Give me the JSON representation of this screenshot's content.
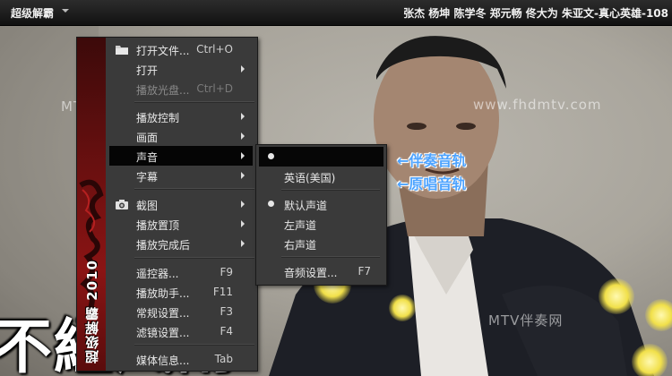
{
  "titlebar": {
    "app_title": "超级解霸",
    "track_title": "张杰 杨坤 陈学冬 郑元畅 佟大为 朱亚文-真心英雄-108"
  },
  "video": {
    "watermarks": [
      "MTV伴奏网",
      "www.fhdmtv.com",
      "MTV伴奏网"
    ],
    "lyric": "不經風雨"
  },
  "menu": {
    "brand": "超级解霸 2010",
    "items": [
      {
        "label": "打开文件...",
        "shortcut": "Ctrl+O",
        "icon": "folder-icon"
      },
      {
        "label": "打开",
        "submenu": true
      },
      {
        "label": "播放光盘...",
        "shortcut": "Ctrl+D",
        "disabled": true
      },
      {
        "label": "播放控制",
        "submenu": true
      },
      {
        "label": "画面",
        "submenu": true
      },
      {
        "label": "声音",
        "submenu": true,
        "active": true
      },
      {
        "label": "字幕",
        "submenu": true
      },
      {
        "label": "截图",
        "submenu": true,
        "icon": "camera-icon"
      },
      {
        "label": "播放置顶",
        "submenu": true
      },
      {
        "label": "播放完成后",
        "submenu": true
      },
      {
        "label": "遥控器...",
        "shortcut": "F9"
      },
      {
        "label": "播放助手...",
        "shortcut": "F11"
      },
      {
        "label": "常规设置...",
        "shortcut": "F3"
      },
      {
        "label": "滤镜设置...",
        "shortcut": "F4"
      },
      {
        "label": "媒体信息...",
        "shortcut": "Tab"
      }
    ]
  },
  "submenu_audio": {
    "items": [
      {
        "label": "",
        "checked": true,
        "highlight": true
      },
      {
        "label": "英语(美国)"
      },
      {
        "label": "默认声道",
        "checked": true
      },
      {
        "label": "左声道"
      },
      {
        "label": "右声道"
      },
      {
        "label": "音频设置...",
        "shortcut": "F7"
      }
    ]
  },
  "annotations": [
    "←伴奏音轨",
    "←原唱音轨"
  ],
  "colors": {
    "menu_bg": "#3a3a3a",
    "menu_active": "#050505",
    "annotation": "#4da3ff",
    "brand_band": "#8a1414"
  }
}
